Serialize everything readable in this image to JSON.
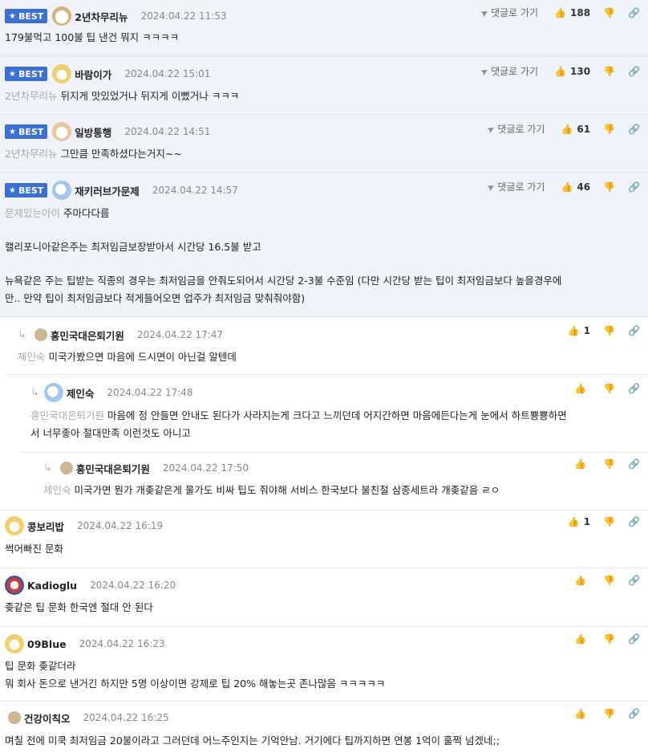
{
  "labels": {
    "best": "BEST",
    "reply": "댓글로 가기"
  },
  "comments": [
    {
      "nick": "2년차무리뉴",
      "date": "2024.04.22 11:53",
      "likes": "188",
      "mention": "",
      "text": "179불먹고 100불 팁 낸건 뭐지 ㅋㅋㅋㅋ"
    },
    {
      "nick": "바람이가",
      "date": "2024.04.22 15:01",
      "likes": "130",
      "mention": "2년차무리뉴",
      "text": "뒤지게 맛있었거나 뒤지게 이뻤거나 ㅋㅋㅋ"
    },
    {
      "nick": "일방통행",
      "date": "2024.04.22 14:51",
      "likes": "61",
      "mention": "2년차무리뉴",
      "text": "그만큼 만족하셨다는거지~~"
    },
    {
      "nick": "재키러브가문제",
      "date": "2024.04.22 14:57",
      "likes": "46",
      "mention": "문제있는아이",
      "text": "주마다다름",
      "text2": "캘리포니아같은주는 최저임금보장받아서 시간당 16.5불 받고",
      "text3": "뉴욕같은 주는 팁받는 직종의 경우는 최저임금을 안줘도되어서 시간당 2-3불 수준임 (다만 시간당 받는 팁이 최저임금보다 높을경우에",
      "text4": "만.. 만약 팁이 최저임금보다 적게들어오면 업주가 최저임금 맞춰줘야함)"
    },
    {
      "nick": "흥민국대은퇴기원",
      "date": "2024.04.22 17:47",
      "likes": "1",
      "mention": "제인숙",
      "text": "미국가봤으면 마음에 드시면이 아닌걸 알텐데"
    },
    {
      "nick": "제인숙",
      "date": "2024.04.22 17:48",
      "likes": "",
      "mention": "흥민국대은퇴기원",
      "text": "마음에 정 안들면 안내도 된다가 사라지는게 크다고 느끼던데 어지간하면 마음에든다는게 눈에서 하트뿅뿅하면",
      "text2": "서 너무좋아 절대만족 이런것도 아니고"
    },
    {
      "nick": "흥민국대은퇴기원",
      "date": "2024.04.22 17:50",
      "likes": "",
      "mention": "제인숙",
      "text": "미국가면 뭔가 개좆같은게 물가도 비싸 팁도 줘야해 서비스 한국보다 불친절 삼종세트라 개좆같음 ㄹㅇ"
    },
    {
      "nick": "콩보리밥",
      "date": "2024.04.22 16:19",
      "likes": "1",
      "mention": "",
      "text": "썩어빠진 문화"
    },
    {
      "nick": "Kadioglu",
      "date": "2024.04.22 16:20",
      "likes": "",
      "mention": "",
      "text": "좆같은 팁 문화 한국엔 절대 안 된다"
    },
    {
      "nick": "09Blue",
      "date": "2024.04.22 16:23",
      "likes": "",
      "mention": "",
      "text": "팁 문화 좆같더라",
      "text2": "뭐 회사 돈으로 낸거긴 하지만 5명 이상이면 강제로 팁 20% 해놓는곳 존나많음 ㅋㅋㅋㅋㅋ"
    },
    {
      "nick": "건강이칙오",
      "date": "2024.04.22 16:25",
      "likes": "",
      "mention": "",
      "text": "며칠 전에 미쿡 최저임금 20불이라고 그러던데 어느주인지는 기억안남. 거기에다 팁까지하면 연봉 1억이 훌쩍 넘겠네;;"
    }
  ]
}
